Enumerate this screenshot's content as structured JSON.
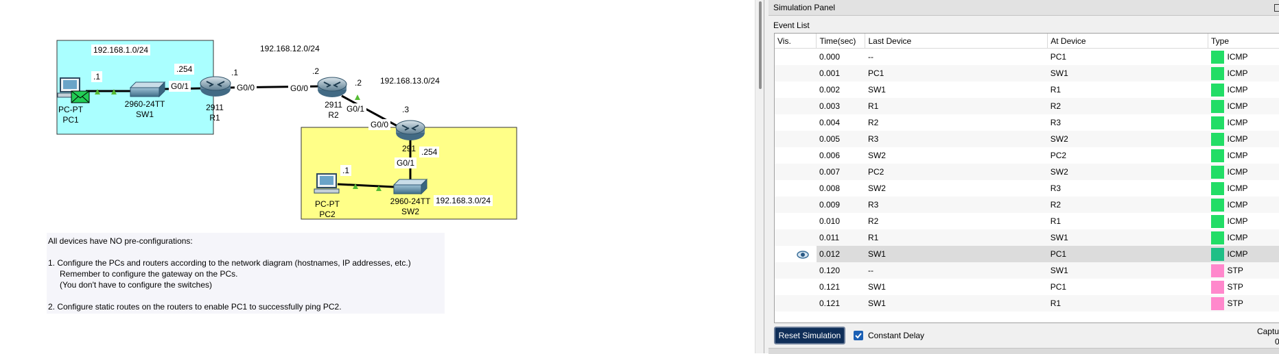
{
  "topology": {
    "networks": {
      "lan1": "192.168.1.0/24",
      "link12": "192.168.12.0/24",
      "link13": "192.168.13.0/24",
      "lan3": "192.168.3.0/24"
    },
    "devices": {
      "pc1": {
        "model": "PC-PT",
        "name": "PC1",
        "ip": ".1"
      },
      "sw1": {
        "model": "2960-24TT",
        "name": "SW1"
      },
      "r1": {
        "model": "2911",
        "name": "R1",
        "lan_ip": ".254",
        "wan_ip": ".1",
        "lan_if": "G0/1",
        "wan_if": "G0/0"
      },
      "r2": {
        "model": "2911",
        "name": "R2",
        "ip12": ".2",
        "ip13": ".2",
        "if12": "G0/0",
        "if13": "G0/1"
      },
      "r3": {
        "model": "291",
        "wan_ip": ".3",
        "lan_ip": ".254",
        "wan_if": "G0/0",
        "lan_if": "G0/1"
      },
      "sw2": {
        "model": "2960-24TT",
        "name": "SW2"
      },
      "pc2": {
        "model": "PC-PT",
        "name": "PC2",
        "ip": ".1"
      }
    },
    "colors": {
      "lan1_area": "#aaffff",
      "lan3_area": "#ffff88"
    }
  },
  "instructions": {
    "line1": "All devices have NO pre-configurations:",
    "line2": "1. Configure the PCs and routers according to the network diagram (hostnames, IP addresses, etc.)",
    "line3": "Remember to configure the gateway on the PCs.",
    "line4": "(You don't have to configure the switches)",
    "line5": "2. Configure static routes on the routers to enable PC1 to successfully ping PC2."
  },
  "panel": {
    "title": "Simulation Panel",
    "event_list_title": "Event List",
    "columns": {
      "vis": "Vis.",
      "time": "Time(sec)",
      "last": "Last Device",
      "at": "At Device",
      "type": "Type"
    },
    "events": [
      {
        "time": "0.000",
        "last": "--",
        "at": "PC1",
        "type": "ICMP",
        "color": "#22dd66"
      },
      {
        "time": "0.001",
        "last": "PC1",
        "at": "SW1",
        "type": "ICMP",
        "color": "#22dd66"
      },
      {
        "time": "0.002",
        "last": "SW1",
        "at": "R1",
        "type": "ICMP",
        "color": "#22dd66"
      },
      {
        "time": "0.003",
        "last": "R1",
        "at": "R2",
        "type": "ICMP",
        "color": "#22dd66"
      },
      {
        "time": "0.004",
        "last": "R2",
        "at": "R3",
        "type": "ICMP",
        "color": "#22dd66"
      },
      {
        "time": "0.005",
        "last": "R3",
        "at": "SW2",
        "type": "ICMP",
        "color": "#22dd66"
      },
      {
        "time": "0.006",
        "last": "SW2",
        "at": "PC2",
        "type": "ICMP",
        "color": "#22dd66"
      },
      {
        "time": "0.007",
        "last": "PC2",
        "at": "SW2",
        "type": "ICMP",
        "color": "#22dd66"
      },
      {
        "time": "0.008",
        "last": "SW2",
        "at": "R3",
        "type": "ICMP",
        "color": "#22dd66"
      },
      {
        "time": "0.009",
        "last": "R3",
        "at": "R2",
        "type": "ICMP",
        "color": "#22dd66"
      },
      {
        "time": "0.010",
        "last": "R2",
        "at": "R1",
        "type": "ICMP",
        "color": "#22dd66"
      },
      {
        "time": "0.011",
        "last": "R1",
        "at": "SW1",
        "type": "ICMP",
        "color": "#22dd66"
      },
      {
        "time": "0.012",
        "last": "SW1",
        "at": "PC1",
        "type": "ICMP",
        "color": "#1fbf86",
        "selected": true
      },
      {
        "time": "0.120",
        "last": "--",
        "at": "SW1",
        "type": "STP",
        "color": "#ff88cc"
      },
      {
        "time": "0.121",
        "last": "SW1",
        "at": "PC1",
        "type": "STP",
        "color": "#ff88cc"
      },
      {
        "time": "0.121",
        "last": "SW1",
        "at": "R1",
        "type": "STP",
        "color": "#ff88cc"
      }
    ],
    "reset_label": "Reset Simulation",
    "constant_delay_label": "Constant Delay",
    "constant_delay_checked": true,
    "capture_label": "Captur",
    "capture_value": "0."
  }
}
